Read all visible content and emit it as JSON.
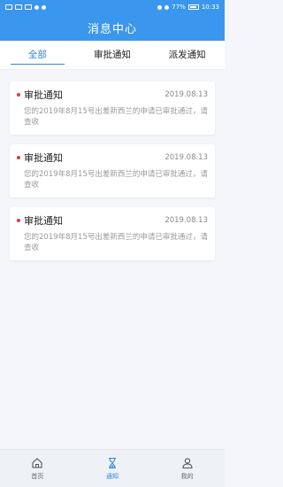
{
  "status_bar": {
    "battery": "77%",
    "time": "10:33"
  },
  "header": {
    "title": "消息中心"
  },
  "tabs": [
    {
      "label": "全部",
      "active": true
    },
    {
      "label": "审批通知",
      "active": false
    },
    {
      "label": "派发通知",
      "active": false
    }
  ],
  "notices": [
    {
      "title": "审批通知",
      "date": "2019.08.13",
      "body": "您的2019年8月15号出差新西兰的申请已审批通过，请查收"
    },
    {
      "title": "审批通知",
      "date": "2019.08.13",
      "body": "您的2019年8月15号出差新西兰的申请已审批通过，请查收"
    },
    {
      "title": "审批通知",
      "date": "2019.08.13",
      "body": "您的2019年8月15号出差新西兰的申请已审批通过，请查收"
    }
  ],
  "bottom_nav": [
    {
      "label": "首页",
      "icon": "home-icon"
    },
    {
      "label": "通知",
      "icon": "hourglass-icon",
      "active": true
    },
    {
      "label": "我的",
      "icon": "user-icon"
    }
  ],
  "colors": {
    "accent": "#3b97ee",
    "unread_dot": "#e23b3b"
  }
}
